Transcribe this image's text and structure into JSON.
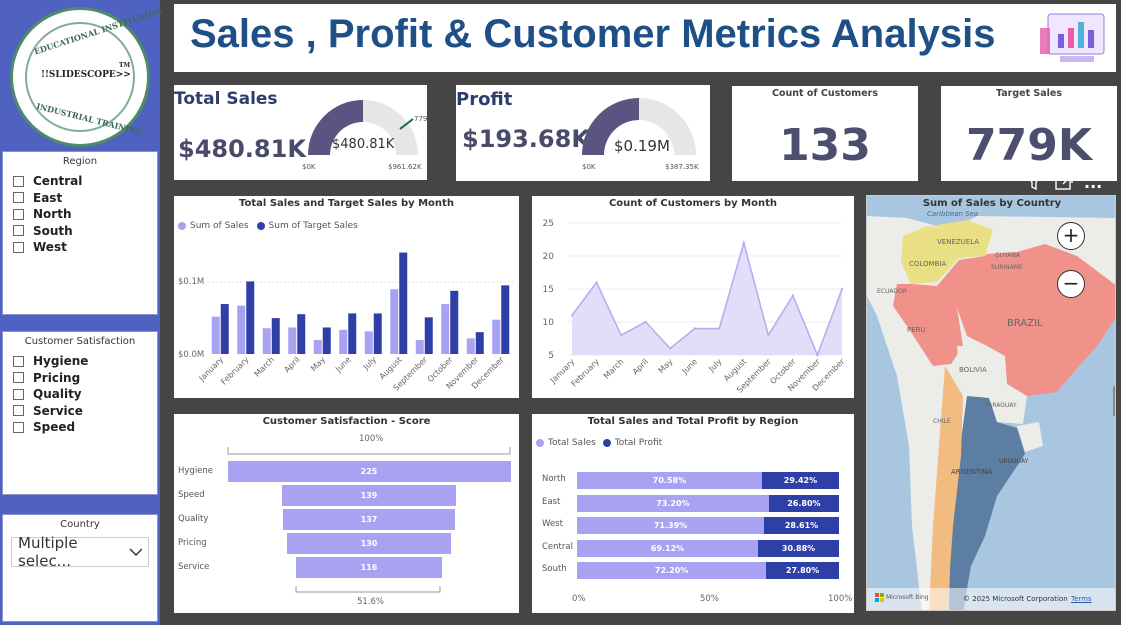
{
  "title": "Sales , Profit & Customer Metrics Analysis",
  "logo": {
    "top_text": "EDUCATIONAL INSTITUTION",
    "center_text": "!!SLIDESCOPE>>",
    "tm": "TM",
    "bottom_text": "INDUSTRIAL TRAINING"
  },
  "region_slicer": {
    "title": "Region",
    "items": [
      "Central",
      "East",
      "North",
      "South",
      "West"
    ]
  },
  "satisfaction_slicer": {
    "title": "Customer Satisfaction",
    "items": [
      "Hygiene",
      "Pricing",
      "Quality",
      "Service",
      "Speed"
    ]
  },
  "country_slicer": {
    "title": "Country",
    "value": "Multiple selec..."
  },
  "kpi_sales": {
    "title": "Total Sales",
    "value": "$480.81K",
    "gauge_value": "$480.81K",
    "min": "$0K",
    "max": "$961.62K",
    "target_label": "779",
    "fill_fraction": 0.5
  },
  "kpi_profit": {
    "title": "Profit",
    "value": "$193.68K",
    "gauge_value": "$0.19M",
    "min": "$0K",
    "max": "$387.35K",
    "fill_fraction": 0.5
  },
  "kpi_customers": {
    "title": "Count of Customers",
    "value": "133"
  },
  "kpi_target": {
    "title": "Target Sales",
    "value": "779K"
  },
  "visual_toolbar": {
    "filter": "filter-icon",
    "focus": "focus-mode-icon",
    "more": "..."
  },
  "chart_sales_month": {
    "title": "Total Sales and Target Sales by Month",
    "legend": [
      "Sum of Sales",
      "Sum of Target Sales"
    ],
    "y_ticks": [
      "$0.1M",
      "$0.0M"
    ],
    "categories": [
      "January",
      "February",
      "March",
      "April",
      "May",
      "June",
      "July",
      "August",
      "September",
      "October",
      "November",
      "December"
    ]
  },
  "chart_customers_month": {
    "title": "Count of Customers by Month",
    "y_ticks": [
      "25",
      "20",
      "15",
      "10",
      "5"
    ],
    "categories": [
      "January",
      "February",
      "March",
      "April",
      "May",
      "June",
      "July",
      "August",
      "September",
      "October",
      "November",
      "December"
    ]
  },
  "chart_satisfaction": {
    "title": "Customer Satisfaction - Score",
    "top_pct": "100%",
    "bottom_pct": "51.6%",
    "categories": [
      "Hygiene",
      "Speed",
      "Quality",
      "Pricing",
      "Service"
    ],
    "value_labels": [
      "225",
      "139",
      "137",
      "130",
      "116"
    ]
  },
  "chart_region": {
    "title": "Total Sales and Total Profit by Region",
    "legend": [
      "Total Sales",
      "Total Profit"
    ],
    "categories": [
      "North",
      "East",
      "West",
      "Central",
      "South"
    ],
    "sales_labels": [
      "70.58%",
      "73.20%",
      "71.39%",
      "69.12%",
      "72.20%"
    ],
    "profit_labels": [
      "29.42%",
      "26.80%",
      "28.61%",
      "30.88%",
      "27.80%"
    ],
    "x_ticks": [
      "0%",
      "50%",
      "100%"
    ]
  },
  "map": {
    "title": "Sum of Sales by Country",
    "zoom_in": "+",
    "zoom_out": "−",
    "labels": {
      "caribbean": "Caribbean Sea",
      "venezuela": "VENEZUELA",
      "colombia": "COLOMBIA",
      "guyana": "GUYANA",
      "suriname": "SURINAME",
      "ecuador": "ECUADOR",
      "peru": "PERU",
      "brazil": "BRAZIL",
      "bolivia": "BOLIVIA",
      "paraguay": "PARAGUAY",
      "chile": "CHILE",
      "argentina": "ARGENTINA",
      "uruguay": "URUGUAY"
    },
    "attribution": "Microsoft Bing",
    "copyright": "© 2025 Microsoft Corporation",
    "terms": "Terms"
  },
  "chart_data": [
    {
      "type": "bar",
      "title": "Total Sales and Target Sales by Month",
      "categories": [
        "January",
        "February",
        "March",
        "April",
        "May",
        "June",
        "July",
        "August",
        "September",
        "October",
        "November",
        "December"
      ],
      "series": [
        {
          "name": "Sum of Sales",
          "values": [
            0.048,
            0.062,
            0.033,
            0.034,
            0.018,
            0.031,
            0.029,
            0.083,
            0.018,
            0.064,
            0.02,
            0.044
          ]
        },
        {
          "name": "Sum of Target Sales",
          "values": [
            0.064,
            0.093,
            0.046,
            0.051,
            0.034,
            0.052,
            0.052,
            0.13,
            0.047,
            0.081,
            0.028,
            0.088
          ]
        }
      ],
      "ylabel": "",
      "ylim": [
        0,
        0.14
      ]
    },
    {
      "type": "area",
      "title": "Count of Customers by Month",
      "categories": [
        "January",
        "February",
        "March",
        "April",
        "May",
        "June",
        "July",
        "August",
        "September",
        "October",
        "November",
        "December"
      ],
      "values": [
        11,
        16,
        8,
        10,
        6,
        9,
        9,
        22,
        8,
        14,
        5,
        15
      ],
      "ylim": [
        5,
        25
      ]
    },
    {
      "type": "bar",
      "title": "Customer Satisfaction - Score",
      "categories": [
        "Hygiene",
        "Speed",
        "Quality",
        "Pricing",
        "Service"
      ],
      "values": [
        225,
        139,
        137,
        130,
        116
      ]
    },
    {
      "type": "bar",
      "title": "Total Sales and Total Profit by Region",
      "categories": [
        "North",
        "East",
        "West",
        "Central",
        "South"
      ],
      "series": [
        {
          "name": "Total Sales",
          "values": [
            70.58,
            73.2,
            71.39,
            69.12,
            72.2
          ]
        },
        {
          "name": "Total Profit",
          "values": [
            29.42,
            26.8,
            28.61,
            30.88,
            27.8
          ]
        }
      ]
    }
  ],
  "colors": {
    "sales": "#a9a2f3",
    "target": "#2f3fa8",
    "sidebar": "#5062c1",
    "title": "#1e4f86",
    "gauge": "#5a5580"
  }
}
